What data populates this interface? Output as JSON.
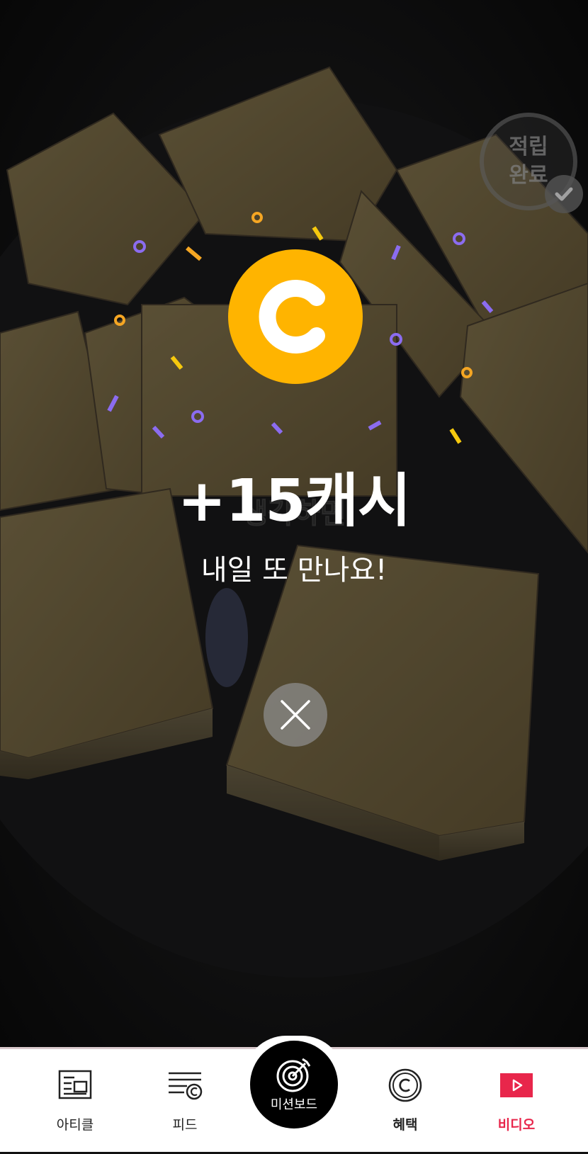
{
  "status": {
    "stamp_line1": "적립",
    "stamp_line2": "완료",
    "stamp_icon": "check-icon"
  },
  "reward": {
    "coin_symbol": "C",
    "amount": "+15캐시",
    "message": "내일 또 만나요!"
  },
  "video": {
    "subtitle": "생각하면"
  },
  "close": {
    "icon": "close-icon"
  },
  "nav": {
    "items": [
      {
        "label": "아티클",
        "icon": "article-icon"
      },
      {
        "label": "피드",
        "icon": "feed-icon"
      },
      {
        "label": "미션보드",
        "icon": "target-icon"
      },
      {
        "label": "혜택",
        "icon": "benefit-coin-icon"
      },
      {
        "label": "비디오",
        "icon": "video-play-icon",
        "active": true
      }
    ],
    "active_color": "#e8264b"
  },
  "colors": {
    "coin": "#ffb400",
    "confetti_purple": "#8b6cf0",
    "confetti_orange": "#f5a623",
    "confetti_yellow": "#f6c90e"
  }
}
